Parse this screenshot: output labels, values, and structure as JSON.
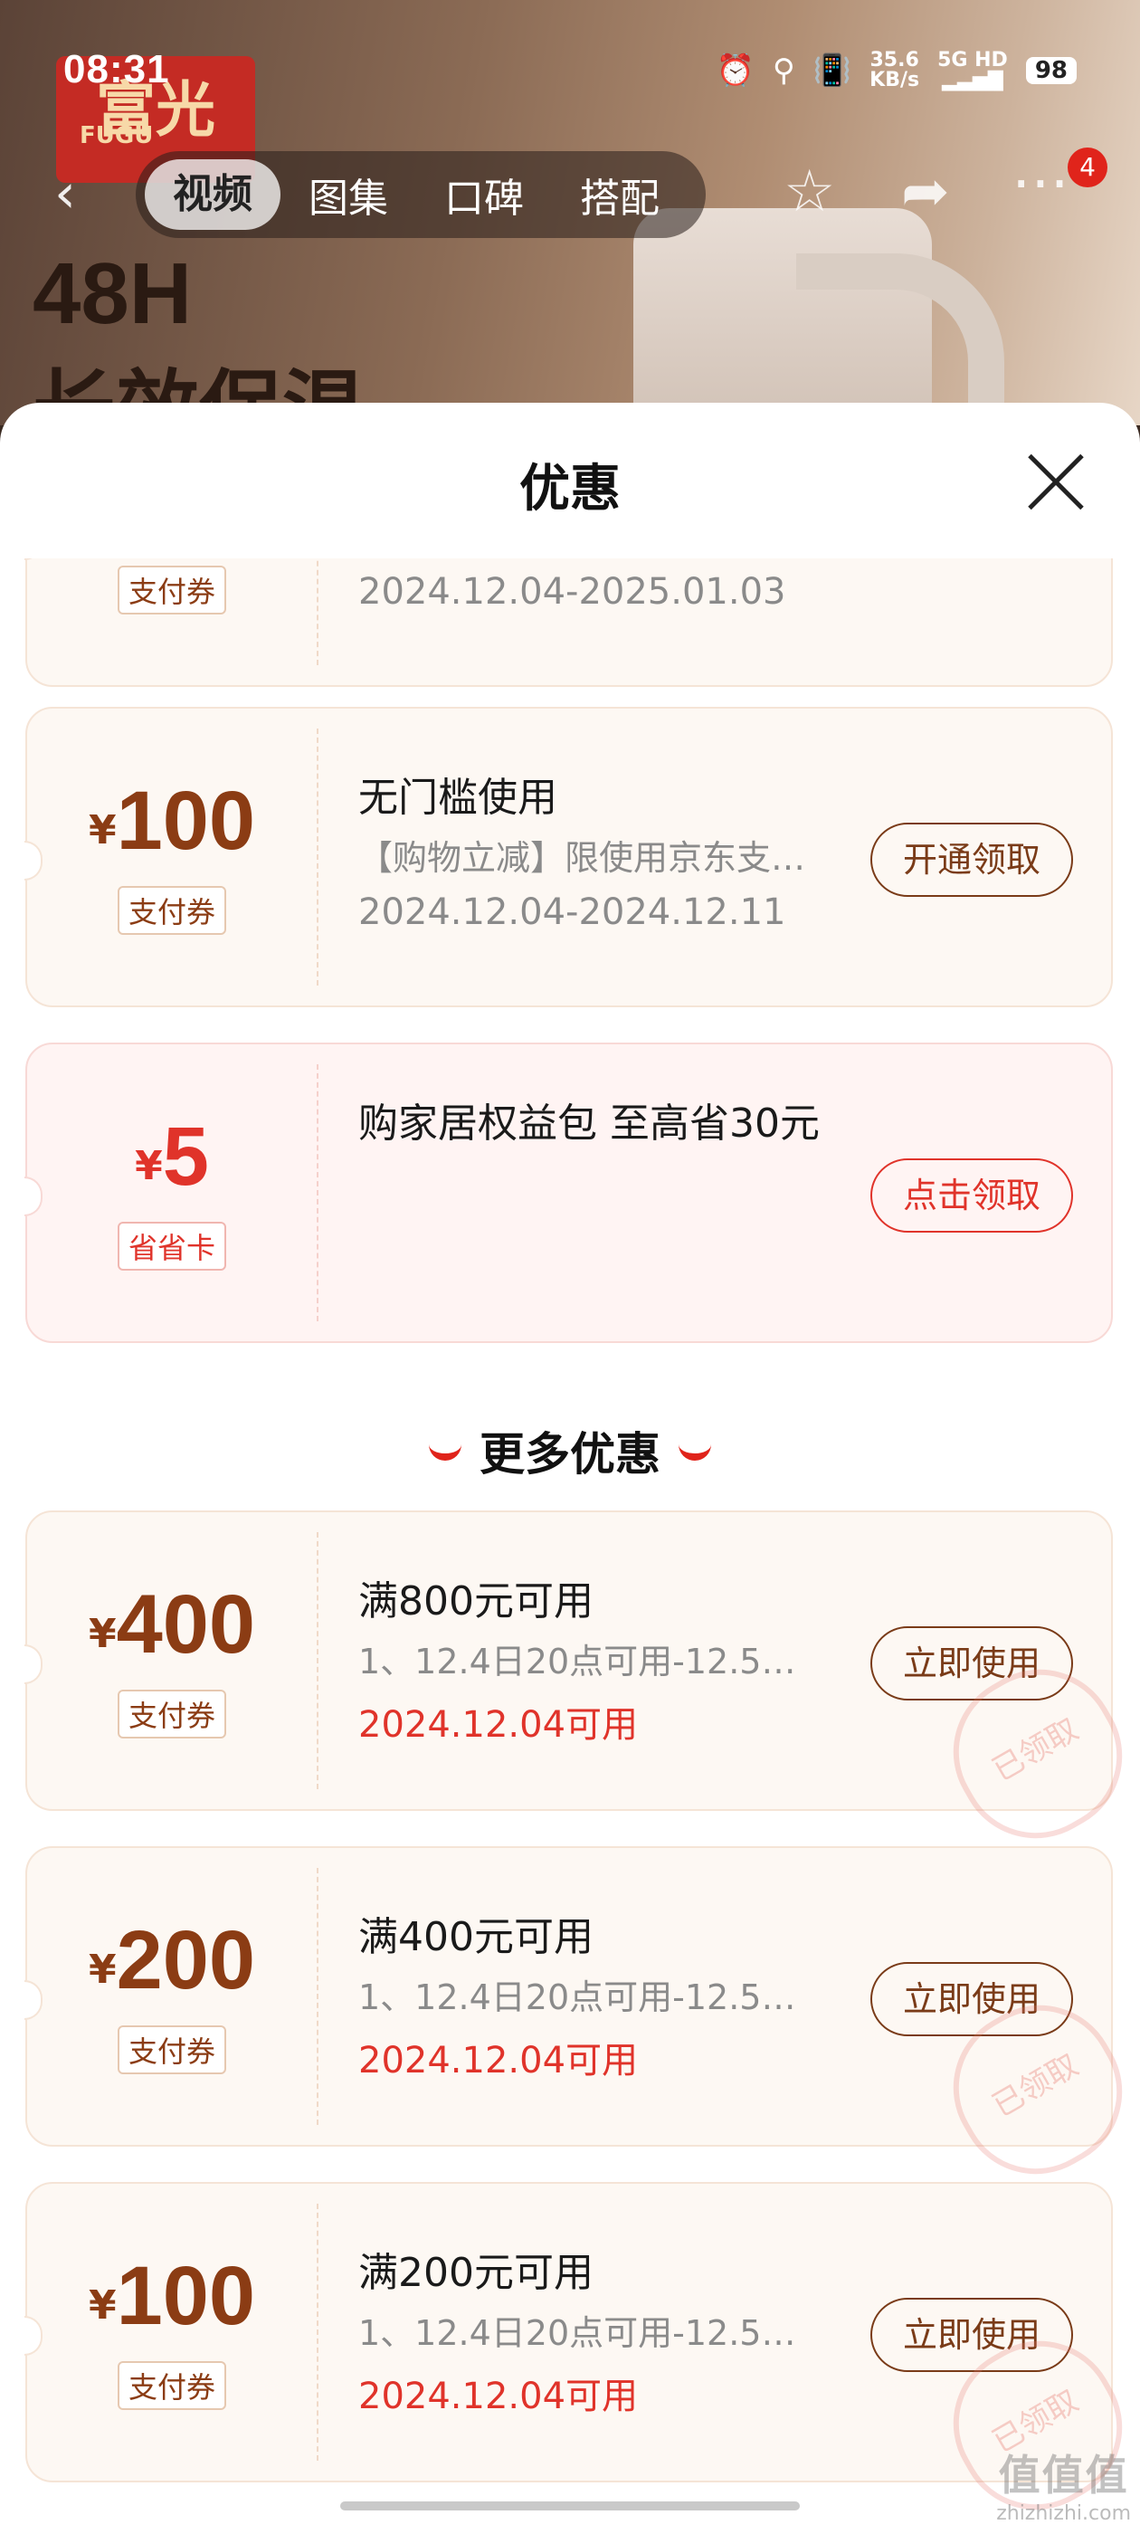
{
  "status": {
    "time": "08:31",
    "net_speed": "35.6",
    "net_unit": "KB/s",
    "net_type": "5G HD",
    "battery": "98"
  },
  "hero": {
    "brand": "富光",
    "brand_sub": "FUGU",
    "line1": "48H",
    "line2": "长效保温"
  },
  "nav": {
    "tabs": [
      "视频",
      "图集",
      "口碑",
      "搭配"
    ],
    "badge": "4"
  },
  "sheet": {
    "title": "优惠"
  },
  "coupons": [
    {
      "currency": "¥",
      "amount": "",
      "tag": "支付券",
      "title": "",
      "desc": "",
      "date": "2024.12.04-2025.01.03",
      "button": ""
    },
    {
      "currency": "¥",
      "amount": "100",
      "tag": "支付券",
      "title": "无门槛使用",
      "desc": "【购物立减】限使用京东支…",
      "date": "2024.12.04-2024.12.11",
      "button": "开通领取"
    },
    {
      "currency": "¥",
      "amount": "5",
      "tag": "省省卡",
      "title": "购家居权益包 至高省30元",
      "button": "点击领取"
    }
  ],
  "more_title": "更多优惠",
  "more_coupons": [
    {
      "currency": "¥",
      "amount": "400",
      "tag": "支付券",
      "title": "满800元可用",
      "desc": "1、12.4日20点可用-12.5…",
      "date": "2024.12.04可用",
      "button": "立即使用",
      "stamp": "已领取"
    },
    {
      "currency": "¥",
      "amount": "200",
      "tag": "支付券",
      "title": "满400元可用",
      "desc": "1、12.4日20点可用-12.5…",
      "date": "2024.12.04可用",
      "button": "立即使用",
      "stamp": "已领取"
    },
    {
      "currency": "¥",
      "amount": "100",
      "tag": "支付券",
      "title": "满200元可用",
      "desc": "1、12.4日20点可用-12.5…",
      "date": "2024.12.04可用",
      "button": "立即使用",
      "stamp": "已领取"
    }
  ],
  "watermark": {
    "logo": "值值值",
    "site": "zhizhizhi.com"
  }
}
